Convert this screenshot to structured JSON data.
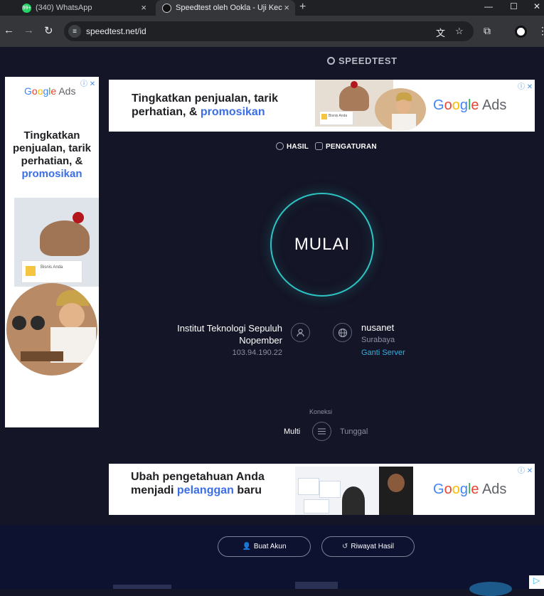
{
  "browser": {
    "tabs": [
      {
        "title": "(340) WhatsApp",
        "badge": "99+",
        "active": false
      },
      {
        "title": "Speedtest oleh Ookla - Uji Kece",
        "active": true
      }
    ],
    "url": "speedtest.net/id",
    "icons": {
      "back": "arrow-left-icon",
      "forward": "arrow-right-icon",
      "reload": "reload-icon",
      "translate": "translate-icon",
      "bookmark": "star-icon",
      "extensions": "puzzle-icon"
    }
  },
  "page": {
    "logo": "SPEEDTEST",
    "ads": {
      "top": {
        "headline_a": "Tingkatkan penjualan, tarik perhatian, & ",
        "headline_b": "promosikan",
        "brand": "Google Ads",
        "card": "Bisnis Anda"
      },
      "side": {
        "brand": "Google Ads",
        "headline_a": "Tingkatkan penjualan, tarik perhatian, & ",
        "headline_b": "promosikan",
        "card": "Bisnis Anda"
      },
      "bottom": {
        "headline_a": "Ubah pengetahuan Anda menjadi ",
        "headline_b": "pelanggan",
        "headline_c": " baru",
        "brand": "Google Ads"
      }
    },
    "nav": {
      "results": "HASIL",
      "settings": "PENGATURAN"
    },
    "go_label": "MULAI",
    "isp": {
      "name": "Institut Teknologi Sepuluh Nopember",
      "ip": "103.94.190.22"
    },
    "server": {
      "name": "nusanet",
      "city": "Surabaya",
      "change": "Ganti Server"
    },
    "connection": {
      "label": "Koneksi",
      "multi": "Multi",
      "single": "Tunggal"
    },
    "footer": {
      "create_account": "Buat Akun",
      "history": "Riwayat Hasil"
    },
    "colors": {
      "background": "#141526",
      "accent": "#2ec4c4",
      "link": "#2bb4e6"
    }
  }
}
